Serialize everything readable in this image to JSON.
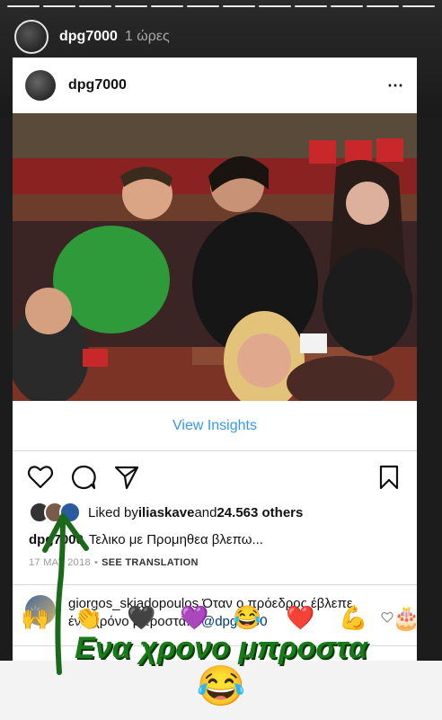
{
  "story": {
    "username": "dpg7000",
    "time_ago": "1 ώρες"
  },
  "post": {
    "username": "dpg7000",
    "more_icon": "⋯",
    "insights_label": "View Insights",
    "likes": {
      "prefix": "Liked by ",
      "user": "iliaskave",
      "middle": " and ",
      "count": "24.563 others"
    },
    "caption": {
      "user": "dpg7000",
      "text": "Τελικο με Προμηθεα βλεπω..."
    },
    "date": "17 MAY 2018",
    "separator": "•",
    "see_translation": "SEE TRANSLATION",
    "comment": {
      "user": "giorgos_skiadopoulos",
      "text": " Όταν ο πρόεδρος έβλεπε ένα χρόνο μπροστά... ",
      "mention": "@dpg7000"
    }
  },
  "reactions": [
    "🙌",
    "👏",
    "🖤",
    "💜",
    "😂",
    "❤️",
    "💪",
    "🎂"
  ],
  "overlay": {
    "text": "Ενα χρονο μπροστα",
    "emoji": "😂",
    "color": "#1a7a1a"
  },
  "colors": {
    "link_blue": "#3897f0",
    "mention_blue": "#00376b"
  }
}
